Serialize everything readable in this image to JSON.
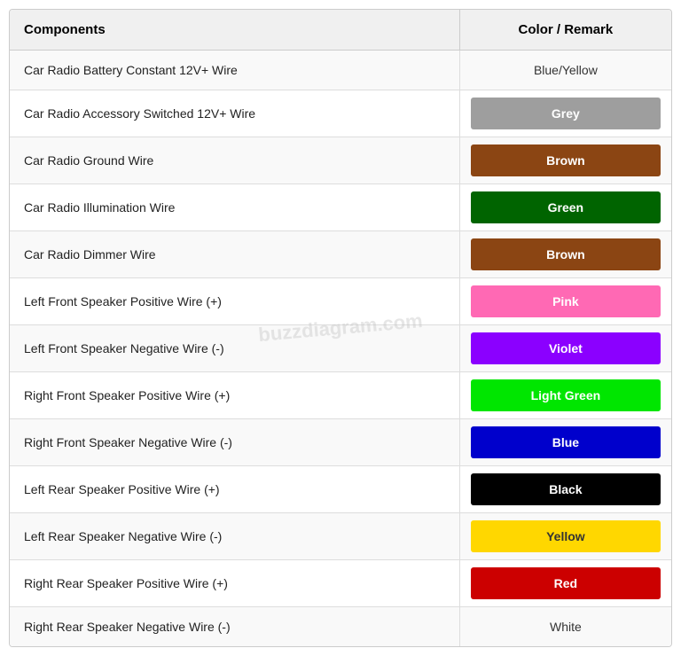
{
  "header": {
    "col1": "Components",
    "col2": "Color / Remark"
  },
  "watermark": "buzzdiagram.com",
  "rows": [
    {
      "component": "Car Radio Battery Constant 12V+ Wire",
      "color_label": "Blue/Yellow",
      "color_bg": null,
      "text_dark": false,
      "plain": true
    },
    {
      "component": "Car Radio Accessory Switched 12V+ Wire",
      "color_label": "Grey",
      "color_bg": "#9e9e9e",
      "text_dark": false,
      "plain": false
    },
    {
      "component": "Car Radio Ground Wire",
      "color_label": "Brown",
      "color_bg": "#8B4513",
      "text_dark": false,
      "plain": false
    },
    {
      "component": "Car Radio Illumination Wire",
      "color_label": "Green",
      "color_bg": "#006400",
      "text_dark": false,
      "plain": false
    },
    {
      "component": "Car Radio Dimmer Wire",
      "color_label": "Brown",
      "color_bg": "#8B4513",
      "text_dark": false,
      "plain": false
    },
    {
      "component": "Left Front Speaker Positive Wire (+)",
      "color_label": "Pink",
      "color_bg": "#FF69B4",
      "text_dark": false,
      "plain": false
    },
    {
      "component": "Left Front Speaker Negative Wire (-)",
      "color_label": "Violet",
      "color_bg": "#8B00FF",
      "text_dark": false,
      "plain": false
    },
    {
      "component": "Right Front Speaker Positive Wire (+)",
      "color_label": "Light Green",
      "color_bg": "#00e600",
      "text_dark": false,
      "plain": false
    },
    {
      "component": "Right Front Speaker Negative Wire (-)",
      "color_label": "Blue",
      "color_bg": "#0000cc",
      "text_dark": false,
      "plain": false
    },
    {
      "component": "Left Rear Speaker Positive Wire (+)",
      "color_label": "Black",
      "color_bg": "#000000",
      "text_dark": false,
      "plain": false
    },
    {
      "component": "Left Rear Speaker Negative Wire (-)",
      "color_label": "Yellow",
      "color_bg": "#FFD700",
      "text_dark": true,
      "plain": false
    },
    {
      "component": "Right Rear Speaker Positive Wire (+)",
      "color_label": "Red",
      "color_bg": "#cc0000",
      "text_dark": false,
      "plain": false
    },
    {
      "component": "Right Rear Speaker Negative Wire (-)",
      "color_label": "White",
      "color_bg": null,
      "text_dark": false,
      "plain": true
    }
  ]
}
